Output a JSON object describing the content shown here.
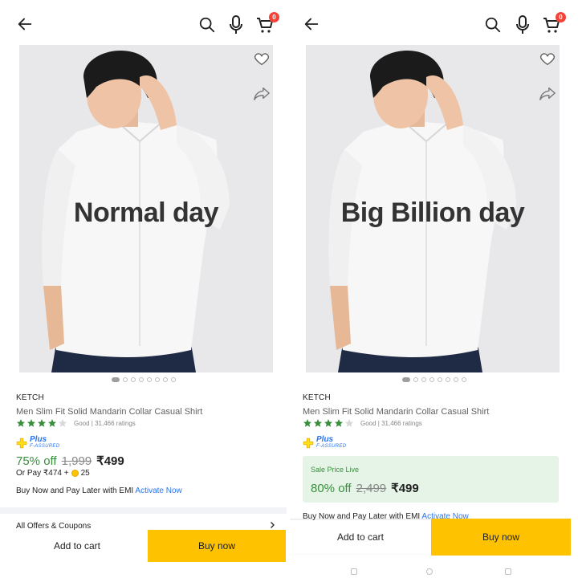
{
  "left": {
    "overlay_text": "Normal day",
    "brand": "KETCH",
    "title": "Men Slim Fit Solid Mandarin Collar Casual Shirt",
    "rating_text": "Good | 31,466 ratings",
    "stars_filled": 4,
    "plus_label": "Plus",
    "plus_sub": "F-ASSURED",
    "discount": "75% off",
    "mrp": "1,999",
    "price": "₹499",
    "or_pay": "Or Pay ₹474 +",
    "coins": "25",
    "emi_text": "Buy Now and Pay Later with EMI",
    "emi_link": "Activate Now",
    "offers_label": "All Offers & Coupons",
    "add_to_cart": "Add to cart",
    "buy_now": "Buy now",
    "cart_count": "0"
  },
  "right": {
    "overlay_text": "Big Billion day",
    "brand": "KETCH",
    "title": "Men Slim Fit Solid Mandarin Collar Casual Shirt",
    "rating_text": "Good | 31,466 ratings",
    "stars_filled": 4,
    "plus_label": "Plus",
    "plus_sub": "F-ASSURED",
    "sale_label": "Sale Price Live",
    "discount": "80% off",
    "mrp": "2,499",
    "price": "₹499",
    "emi_text": "Buy Now and Pay Later with EMI",
    "emi_link": "Activate Now",
    "add_to_cart": "Add to cart",
    "buy_now": "Buy now",
    "cart_count": "0"
  },
  "icons": {
    "back": "arrow-left",
    "search": "magnifier",
    "mic": "microphone",
    "cart": "shopping-cart",
    "wishlist": "heart-outline",
    "share": "share-arrow",
    "star": "star",
    "chevron": "chevron-right"
  },
  "colors": {
    "accent_yellow": "#ffc200",
    "discount_green": "#388e3c",
    "link_blue": "#2874f0",
    "star_green": "#388e3c",
    "sale_bg": "#e6f4e7",
    "badge_red": "#f44336"
  }
}
